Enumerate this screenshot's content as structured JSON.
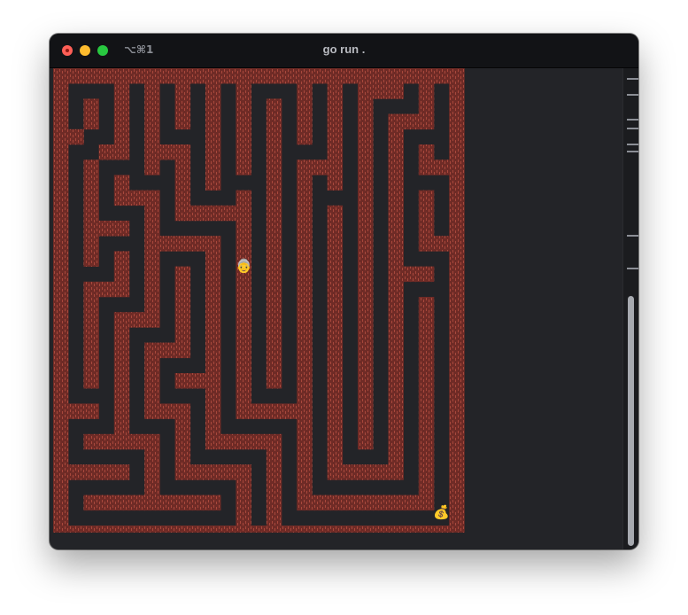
{
  "window": {
    "title": "go run .",
    "shortcut": "⌥⌘1"
  },
  "game": {
    "player_icon": "person-face-icon",
    "player_glyph": "👵",
    "goal_icon": "money-bag-icon",
    "goal_glyph": "💰",
    "colors": {
      "wall": "#6f2b26",
      "wall_texture": "#a8483c",
      "path": "#232428"
    },
    "maze": [
      "###########################",
      "#...#.#.#.#.#...#.#.###.#.#",
      "#.#.#.#.#.#.#.#.#.#.#...#.#",
      "#.#.#.#.#.#.#.#.#.#.#.###.#",
      "##..#.#...#.#.#.#.#.#.#...#",
      "#..##.###.#.#.#...#.#.#.#.#",
      "#.#...#.#.#.#.#.###.#.#.###",
      "#.#.#...#.#...#.#.#.#.#...#",
      "#.#.###.#...#.#.#...#.#.#.#",
      "#.#...#.#####.#.#.#.#.#.#.#",
      "#.###.#.....#.#.#.#.#.#.#.#",
      "#.#...#####.#.#.#.#.#.#.###",
      "#.#.#.#...#.#.#.#.#.#.#...#",
      "#...#.#.#.#.#.#.#.#.#.###.#",
      "#.###.#.#.#.#.#.#.#.#.#...#",
      "#.#...#.#.#.#.#.#.#.#.#.#.#",
      "#.#.###.#.#.#.#.#.#.#.#.#.#",
      "#.#.#...#.#.#.#.#.#.#.#.#.#",
      "#.#.#.###.#.#.#.#.#.#.#.#.#",
      "#.#.#.#...#.#.#.#.#.#.#.#.#",
      "#.#.#.#.###.#.#.#.#.#.#.#.#",
      "#...#.#...#.#...#.#.#.#.#.#",
      "###.#.###.#.#####.#.#.#.#.#",
      "#...#...#.#.....#.#.#.#.#.#",
      "#.#####.#.#####.#.#.#.#.#.#",
      "#.....#.#.....#.#.#...#.#.#",
      "#####.#.#####.#.#.#####.#.#",
      "#.....#.....#.#.#.......#.#",
      "#.#########.#.#.#########.#",
      "#...........#.#...........#",
      "###########################"
    ]
  }
}
